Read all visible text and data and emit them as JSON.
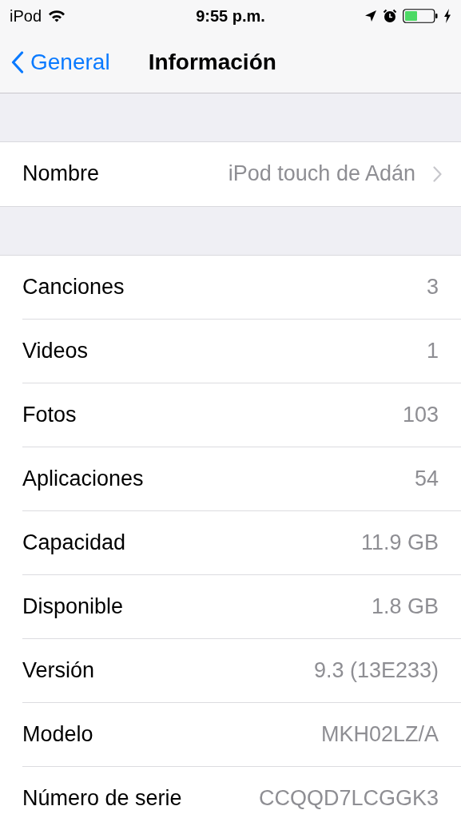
{
  "status_bar": {
    "carrier": "iPod",
    "time": "9:55 p.m."
  },
  "nav_bar": {
    "back": "General",
    "title": "Información"
  },
  "sections": [
    {
      "rows": [
        {
          "kind": "link",
          "label": "Nombre",
          "value": "iPod touch de Adán"
        }
      ]
    },
    {
      "rows": [
        {
          "kind": "value",
          "label": "Canciones",
          "value": "3"
        },
        {
          "kind": "value",
          "label": "Videos",
          "value": "1"
        },
        {
          "kind": "value",
          "label": "Fotos",
          "value": "103"
        },
        {
          "kind": "value",
          "label": "Aplicaciones",
          "value": "54"
        },
        {
          "kind": "value",
          "label": "Capacidad",
          "value": "11.9 GB"
        },
        {
          "kind": "value",
          "label": "Disponible",
          "value": "1.8 GB"
        },
        {
          "kind": "value",
          "label": "Versión",
          "value": "9.3 (13E233)"
        },
        {
          "kind": "value",
          "label": "Modelo",
          "value": "MKH02LZ/A"
        },
        {
          "kind": "value",
          "label": "Número de serie",
          "value": "CCQQD7LCGGK3"
        }
      ]
    }
  ]
}
